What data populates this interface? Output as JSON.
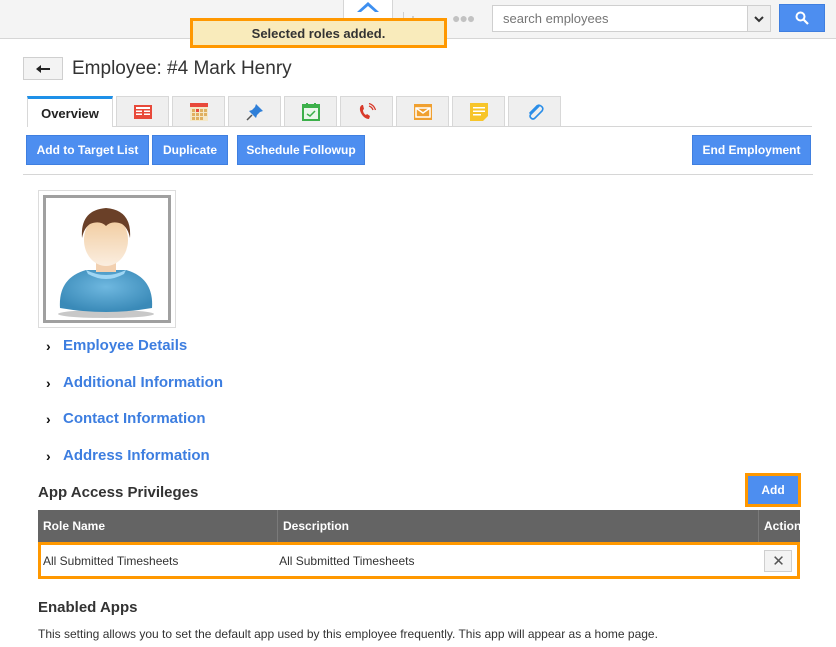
{
  "topbar": {
    "home_icon": "home-icon",
    "chart_icon": "bar-chart-icon",
    "more_icon": "more-dots-icon",
    "search": {
      "placeholder": "search employees",
      "value": ""
    },
    "search_dropdown_icon": "chevron-down-icon",
    "search_button_icon": "search-icon"
  },
  "toast": {
    "message": "Selected roles added."
  },
  "header": {
    "back_icon": "back-arrow-icon",
    "title": "Employee: #4 Mark Henry"
  },
  "tabs": [
    {
      "label": "Overview",
      "active": true
    },
    {
      "icon": "list-icon"
    },
    {
      "icon": "calendar-icon"
    },
    {
      "icon": "pin-icon"
    },
    {
      "icon": "task-icon"
    },
    {
      "icon": "phone-icon"
    },
    {
      "icon": "email-icon"
    },
    {
      "icon": "note-icon"
    },
    {
      "icon": "attachment-icon"
    }
  ],
  "actions": {
    "add_to_target_list": "Add to Target List",
    "duplicate": "Duplicate",
    "schedule_followup": "Schedule Followup",
    "end_employment": "End Employment"
  },
  "sections": [
    {
      "label": "Employee Details"
    },
    {
      "label": "Additional Information"
    },
    {
      "label": "Contact Information"
    },
    {
      "label": "Address Information"
    }
  ],
  "app_access": {
    "title": "App Access Privileges",
    "add_label": "Add",
    "columns": [
      "Role Name",
      "Description",
      "Action"
    ],
    "rows": [
      {
        "role_name": "All Submitted Timesheets",
        "description": "All Submitted Timesheets",
        "action_icon": "close-icon"
      }
    ]
  },
  "enabled_apps": {
    "title": "Enabled Apps",
    "description": "This setting allows you to set the default app used by this employee frequently. This app will appear as a home page."
  },
  "colors": {
    "primary": "#4d8ef0",
    "highlight": "#ff9800",
    "toast_bg": "#f9ebbb",
    "link": "#3d7ee0",
    "table_header": "#646464"
  }
}
